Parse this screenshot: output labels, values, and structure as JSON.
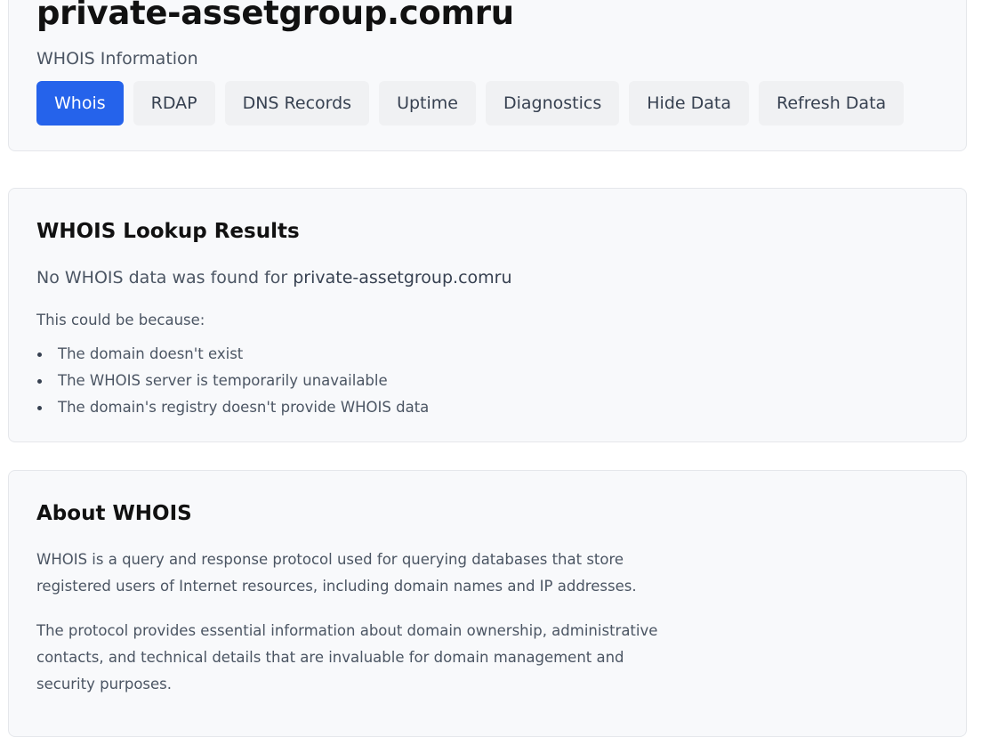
{
  "header": {
    "domain": "private-assetgroup.comru",
    "subtitle": "WHOIS Information",
    "tabs": [
      {
        "label": "Whois",
        "active": true
      },
      {
        "label": "RDAP",
        "active": false
      },
      {
        "label": "DNS Records",
        "active": false
      },
      {
        "label": "Uptime",
        "active": false
      },
      {
        "label": "Diagnostics",
        "active": false
      },
      {
        "label": "Hide Data",
        "active": false
      },
      {
        "label": "Refresh Data",
        "active": false
      }
    ]
  },
  "lookup": {
    "heading": "WHOIS Lookup Results",
    "no_data_prefix": "No WHOIS data was found for ",
    "domain": "private-assetgroup.comru",
    "reason_intro": "This could be because:",
    "reasons": [
      "The domain doesn't exist",
      "The WHOIS server is temporarily unavailable",
      "The domain's registry doesn't provide WHOIS data"
    ]
  },
  "about": {
    "heading": "About WHOIS",
    "paragraphs": [
      "WHOIS is a query and response protocol used for querying databases that store registered users of Internet resources, including domain names and IP addresses.",
      "The protocol provides essential information about domain ownership, administrative contacts, and technical details that are invaluable for domain management and security purposes."
    ]
  },
  "colors": {
    "accent": "#2563eb",
    "tab_bg": "#f0f1f3",
    "card_bg": "#f8f9fb"
  }
}
